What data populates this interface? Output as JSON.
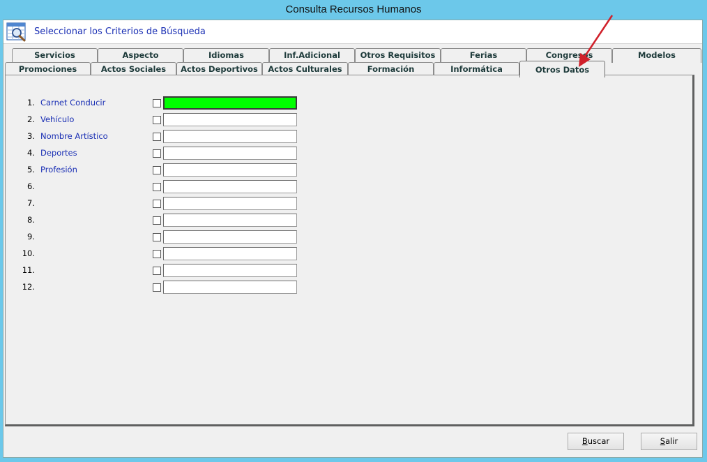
{
  "window": {
    "title": "Consulta Recursos Humanos"
  },
  "criteria": {
    "title": "Seleccionar los Criterios de Búsqueda",
    "icon": "search-grid-icon"
  },
  "tabs_back": [
    "Servicios",
    "Aspecto",
    "Idiomas",
    "Inf.Adicional",
    "Otros Requisitos",
    "Ferias",
    "Congresos",
    "Modelos"
  ],
  "tabs_front": [
    "Promociones",
    "Actos Sociales",
    "Actos Deportivos",
    "Actos Culturales",
    "Formación",
    "Informática",
    "Otros Datos"
  ],
  "active_tab": "Otros Datos",
  "rows": [
    {
      "num": "1.",
      "label": "Carnet Conducir",
      "value": ""
    },
    {
      "num": "2.",
      "label": "Vehículo",
      "value": ""
    },
    {
      "num": "3.",
      "label": "Nombre Artístico",
      "value": ""
    },
    {
      "num": "4.",
      "label": "Deportes",
      "value": ""
    },
    {
      "num": "5.",
      "label": "Profesión",
      "value": ""
    },
    {
      "num": "6.",
      "label": "",
      "value": ""
    },
    {
      "num": "7.",
      "label": "",
      "value": ""
    },
    {
      "num": "8.",
      "label": "",
      "value": ""
    },
    {
      "num": "9.",
      "label": "",
      "value": ""
    },
    {
      "num": "10.",
      "label": "",
      "value": ""
    },
    {
      "num": "11.",
      "label": "",
      "value": ""
    },
    {
      "num": "12.",
      "label": "",
      "value": ""
    }
  ],
  "buttons": {
    "search": {
      "first": "B",
      "rest": "uscar"
    },
    "exit": {
      "first": "S",
      "rest": "alir"
    }
  },
  "colors": {
    "highlight": "#00ff00",
    "label": "#1a2fb4",
    "titlebar": "#6cc8ea",
    "annotation_arrow": "#d0202a"
  }
}
